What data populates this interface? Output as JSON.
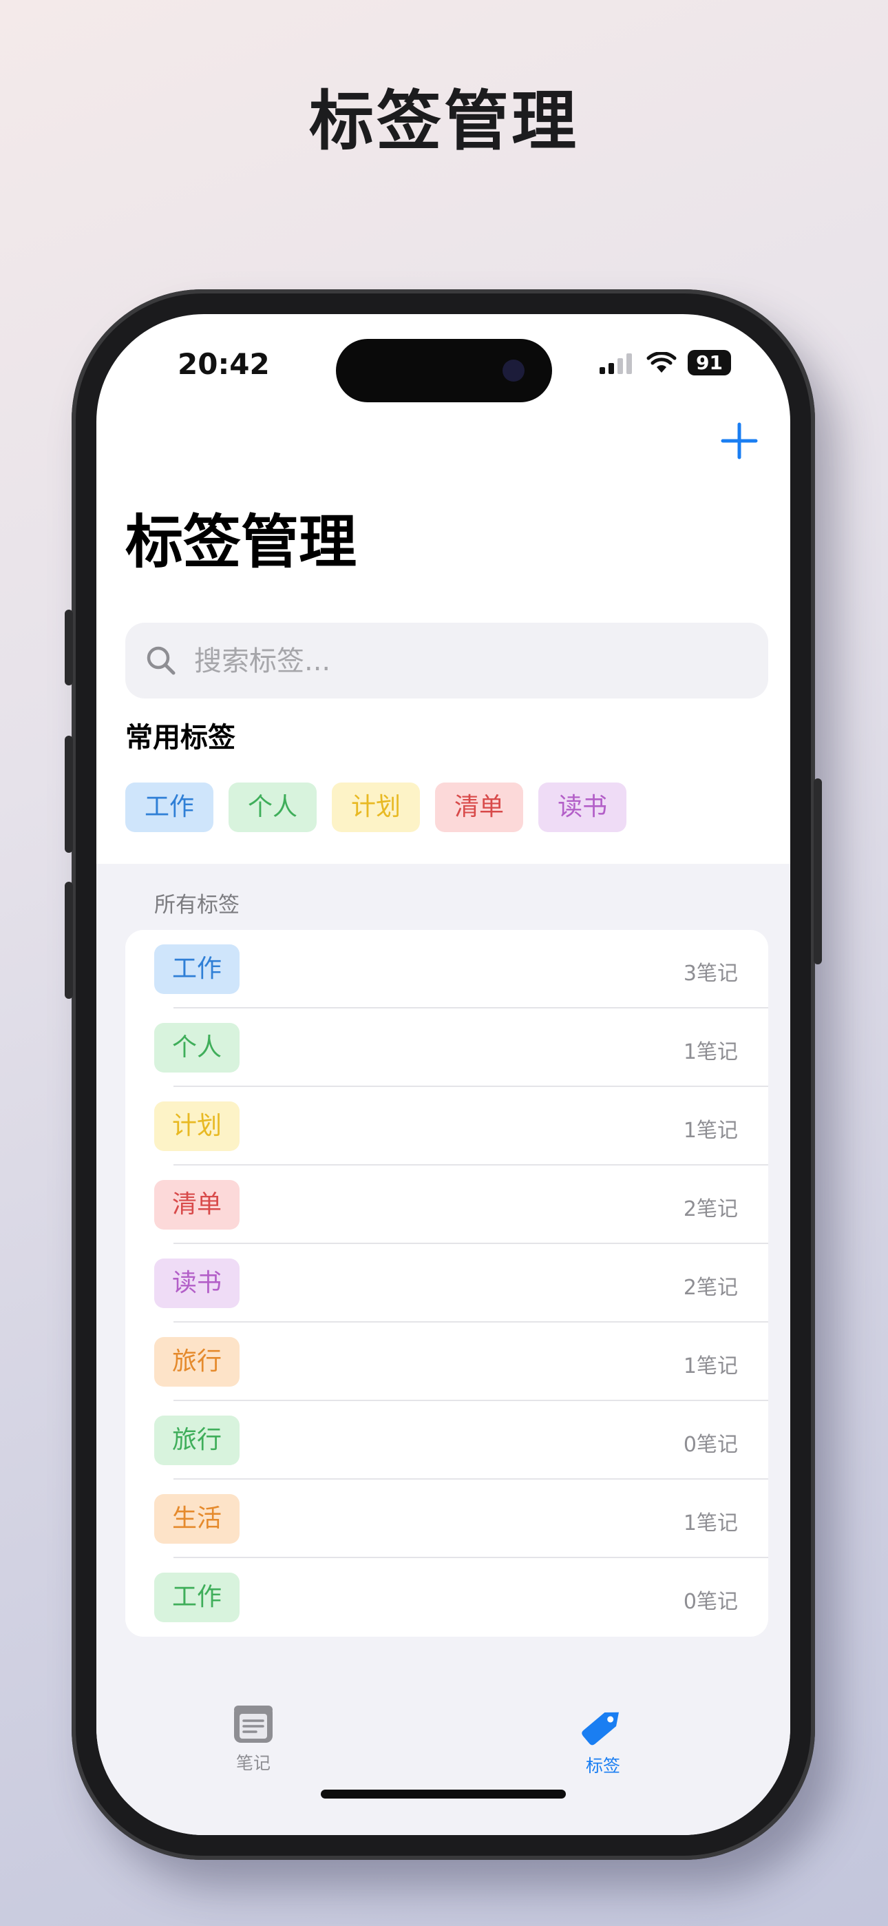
{
  "page_title": "标签管理",
  "status": {
    "time": "20:42",
    "battery": "91"
  },
  "nav": {
    "title": "标签管理",
    "add_icon": "plus-icon"
  },
  "search": {
    "placeholder": "搜索标签...",
    "value": ""
  },
  "frequent": {
    "title": "常用标签",
    "chips": [
      {
        "label": "工作",
        "bg": "#cfe5fb",
        "fg": "#2f7fd6"
      },
      {
        "label": "个人",
        "bg": "#d8f3dd",
        "fg": "#3fae5a"
      },
      {
        "label": "计划",
        "bg": "#fdf3c7",
        "fg": "#e8b923"
      },
      {
        "label": "清单",
        "bg": "#fcd9d9",
        "fg": "#d84a4a"
      },
      {
        "label": "读书",
        "bg": "#efdcf6",
        "fg": "#b35fc8"
      }
    ]
  },
  "all_tags": {
    "header": "所有标签",
    "rows": [
      {
        "label": "工作",
        "count": "3笔记",
        "bg": "#cfe5fb",
        "fg": "#2f7fd6"
      },
      {
        "label": "个人",
        "count": "1笔记",
        "bg": "#d8f3dd",
        "fg": "#3fae5a"
      },
      {
        "label": "计划",
        "count": "1笔记",
        "bg": "#fdf3c7",
        "fg": "#e8b923"
      },
      {
        "label": "清单",
        "count": "2笔记",
        "bg": "#fcd9d9",
        "fg": "#d84a4a"
      },
      {
        "label": "读书",
        "count": "2笔记",
        "bg": "#efdcf6",
        "fg": "#b35fc8"
      },
      {
        "label": "旅行",
        "count": "1笔记",
        "bg": "#fde3c8",
        "fg": "#e58a2c"
      },
      {
        "label": "旅行",
        "count": "0笔记",
        "bg": "#d8f3dd",
        "fg": "#3fae5a"
      },
      {
        "label": "生活",
        "count": "1笔记",
        "bg": "#fde3c8",
        "fg": "#e58a2c"
      },
      {
        "label": "工作",
        "count": "0笔记",
        "bg": "#d8f3dd",
        "fg": "#3fae5a"
      }
    ]
  },
  "tabs": [
    {
      "label": "笔记",
      "icon": "notes-icon",
      "active": false
    },
    {
      "label": "标签",
      "icon": "tag-icon",
      "active": true
    }
  ],
  "colors": {
    "accent": "#1a7ef2",
    "inactive": "#8e8e93"
  }
}
